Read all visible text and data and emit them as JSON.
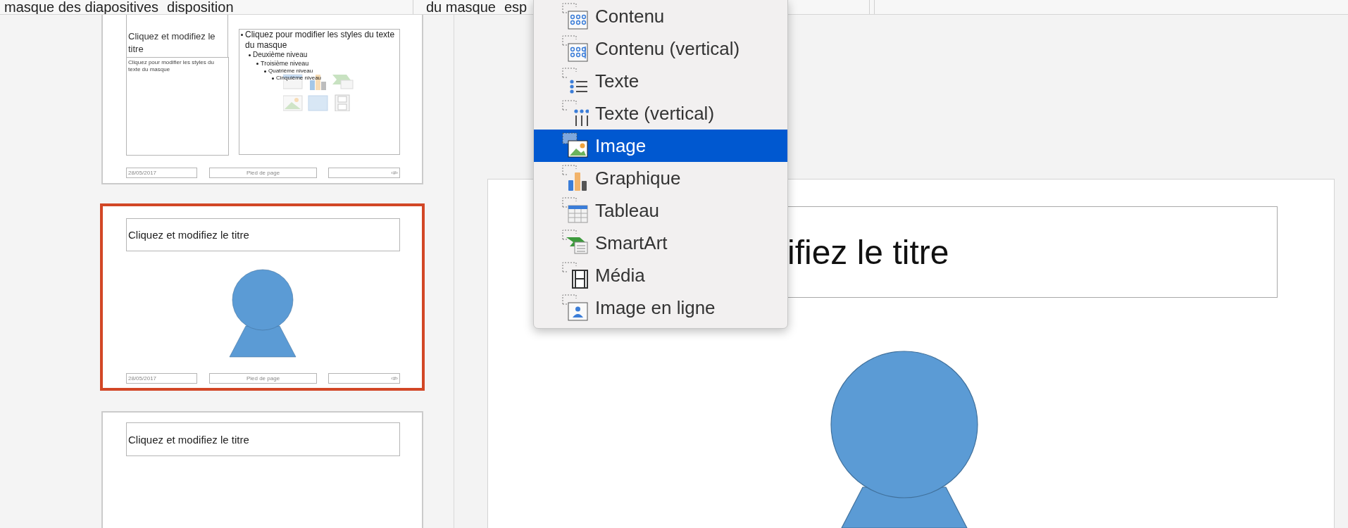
{
  "ribbon": {
    "groups": [
      {
        "labels": [
          "masque des diapositives",
          "disposition"
        ]
      },
      {
        "labels": [
          "du masque",
          "esp"
        ]
      }
    ]
  },
  "thumbnails": [
    {
      "kind": "title-content",
      "selected": false,
      "title": "Cliquez et modifiez le titre",
      "body": "Cliquez pour modifier les styles du texte du masque",
      "bullets": [
        {
          "text": "Cliquez pour modifier les styles du texte du masque",
          "children": [
            {
              "text": "Deuxième niveau",
              "children": [
                {
                  "text": "Troisième niveau",
                  "children": [
                    {
                      "text": "Quatrième niveau",
                      "children": [
                        {
                          "text": "Cinquième niveau"
                        }
                      ]
                    }
                  ]
                }
              ]
            }
          ]
        }
      ],
      "footer": {
        "date": "28/05/2017",
        "center": "Pied de page",
        "number": "‹#›"
      }
    },
    {
      "kind": "title-figure",
      "selected": true,
      "title": "Cliquez et modifiez le titre",
      "footer": {
        "date": "28/05/2017",
        "center": "Pied de page",
        "number": "‹#›"
      }
    },
    {
      "kind": "title-only",
      "selected": false,
      "title": "Cliquez et modifiez le titre"
    }
  ],
  "slide": {
    "title": "ifiez le titre"
  },
  "menu": {
    "items": [
      {
        "kind": "content",
        "label": "Contenu",
        "selected": false
      },
      {
        "kind": "content-vertical",
        "label": "Contenu (vertical)",
        "selected": false
      },
      {
        "kind": "text",
        "label": "Texte",
        "selected": false
      },
      {
        "kind": "text-vertical",
        "label": "Texte (vertical)",
        "selected": false
      },
      {
        "kind": "picture",
        "label": "Image",
        "selected": true
      },
      {
        "kind": "chart",
        "label": "Graphique",
        "selected": false
      },
      {
        "kind": "table",
        "label": "Tableau",
        "selected": false
      },
      {
        "kind": "smartart",
        "label": "SmartArt",
        "selected": false
      },
      {
        "kind": "media",
        "label": "Média",
        "selected": false
      },
      {
        "kind": "online-picture",
        "label": "Image en ligne",
        "selected": false
      }
    ]
  }
}
